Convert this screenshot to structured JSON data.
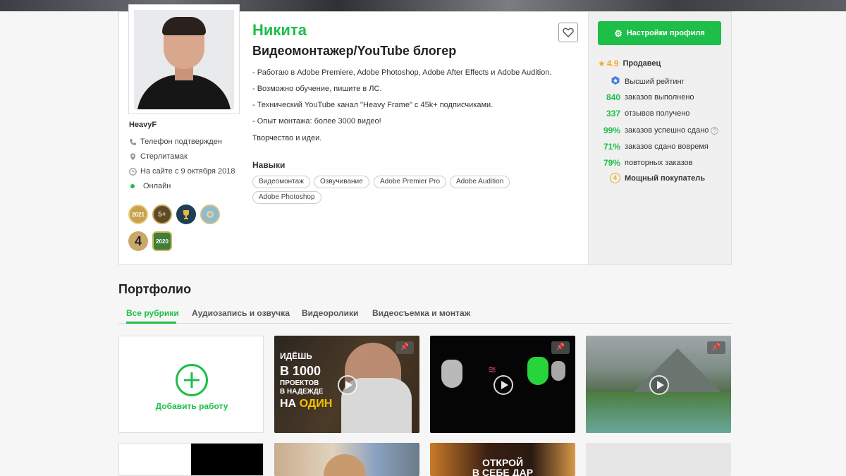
{
  "profile": {
    "name": "Никита",
    "headline": "Видеомонтажер/YouTube блогер",
    "description": [
      "- Работаю в Adobe Premiere, Adobe Photoshop, Adobe After Effects и Adobe Audition.",
      "- Возможно обучение, пишите в ЛС.",
      "- Технический YouTube канал \"Heavy Frame\" с 45k+ подписчиками.",
      "- Опыт монтажа: более 3000 видео!",
      "Творчество и идеи."
    ],
    "username": "HeavyF",
    "phone": "Телефон подтвержден",
    "city": "Стерлитамак",
    "since": "На сайте с 9 октября 2018",
    "status": "Онлайн",
    "skills_label": "Навыки",
    "skills": [
      "Видеомонтаж",
      "Озвучивание",
      "Adobe Premier Pro",
      "Adobe Audition",
      "Adobe Photoshop"
    ],
    "badges": [
      {
        "icon": "badge-2021-100-icon",
        "text": "2021",
        "color": "#c8a24a"
      },
      {
        "icon": "badge-5plus-icon",
        "text": "5+",
        "color": "#b08c3c"
      },
      {
        "icon": "trophy-icon",
        "text": "",
        "color": "#1f3f56"
      },
      {
        "icon": "medal-blue-icon",
        "text": "",
        "color": "#8bbbd9"
      },
      {
        "icon": "badge-level-4-icon",
        "text": "4",
        "color": "#c9a86a"
      },
      {
        "icon": "badge-2020-300-icon",
        "text": "2020",
        "color": "#3f7f3a"
      }
    ]
  },
  "actions": {
    "settings_label": "Настройки профиля"
  },
  "stats": {
    "rating": "4.9",
    "role": "Продавец",
    "top_rating": "Высший рейтинг",
    "rows": [
      {
        "num": "840",
        "label": "заказов выполнено"
      },
      {
        "num": "337",
        "label": "отзывов получено"
      },
      {
        "num": "99%",
        "label": "заказов успешно сдано"
      },
      {
        "num": "71%",
        "label": "заказов сдано вовремя"
      },
      {
        "num": "79%",
        "label": "повторных заказов"
      }
    ],
    "buyer_level": "4",
    "buyer_label": "Мощный покупатель"
  },
  "portfolio": {
    "heading": "Портфолио",
    "tabs": [
      "Все рубрики",
      "Аудиозапись и озвучка",
      "Видеоролики",
      "Видеосъемка и монтаж"
    ],
    "add_label": "Добавить работу",
    "thumb1_text": [
      "ИДЁШЬ",
      "В 1000",
      "ПРОЕКТОВ",
      "В НАДЕЖДЕ",
      "НА",
      "ОДИН"
    ],
    "thumb_bottom_text": [
      "ОТКРОЙ",
      "В СЕБЕ ДАР"
    ]
  },
  "colors": {
    "accent": "#1dbf49",
    "star": "#f5a623"
  }
}
